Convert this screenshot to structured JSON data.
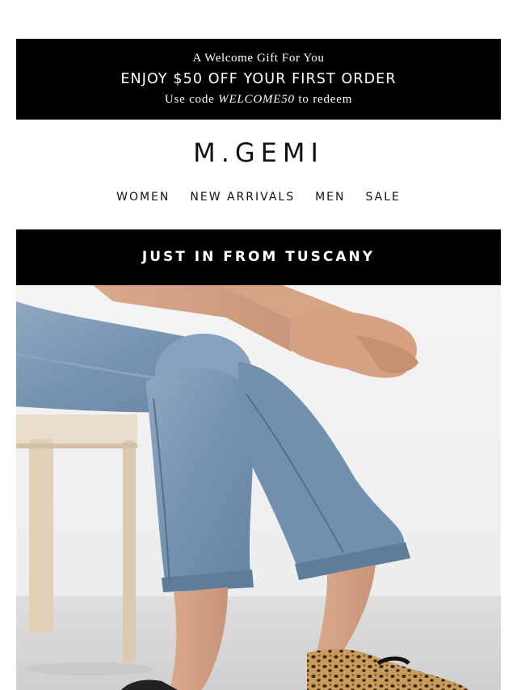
{
  "promo": {
    "eyebrow": "A Welcome Gift For You",
    "headline": "ENJOY $50 OFF YOUR FIRST ORDER",
    "code_prefix": "Use code ",
    "code": "WELCOME50",
    "code_suffix": " to redeem"
  },
  "brand": {
    "logo": "M.GEMI"
  },
  "nav": {
    "items": [
      {
        "label": "WOMEN"
      },
      {
        "label": "NEW ARRIVALS"
      },
      {
        "label": "MEN"
      },
      {
        "label": "SALE"
      }
    ]
  },
  "banner": {
    "title": "JUST IN FROM TUSCANY"
  },
  "colors": {
    "black": "#000000",
    "white": "#ffffff",
    "denim": "#7d99b5"
  }
}
